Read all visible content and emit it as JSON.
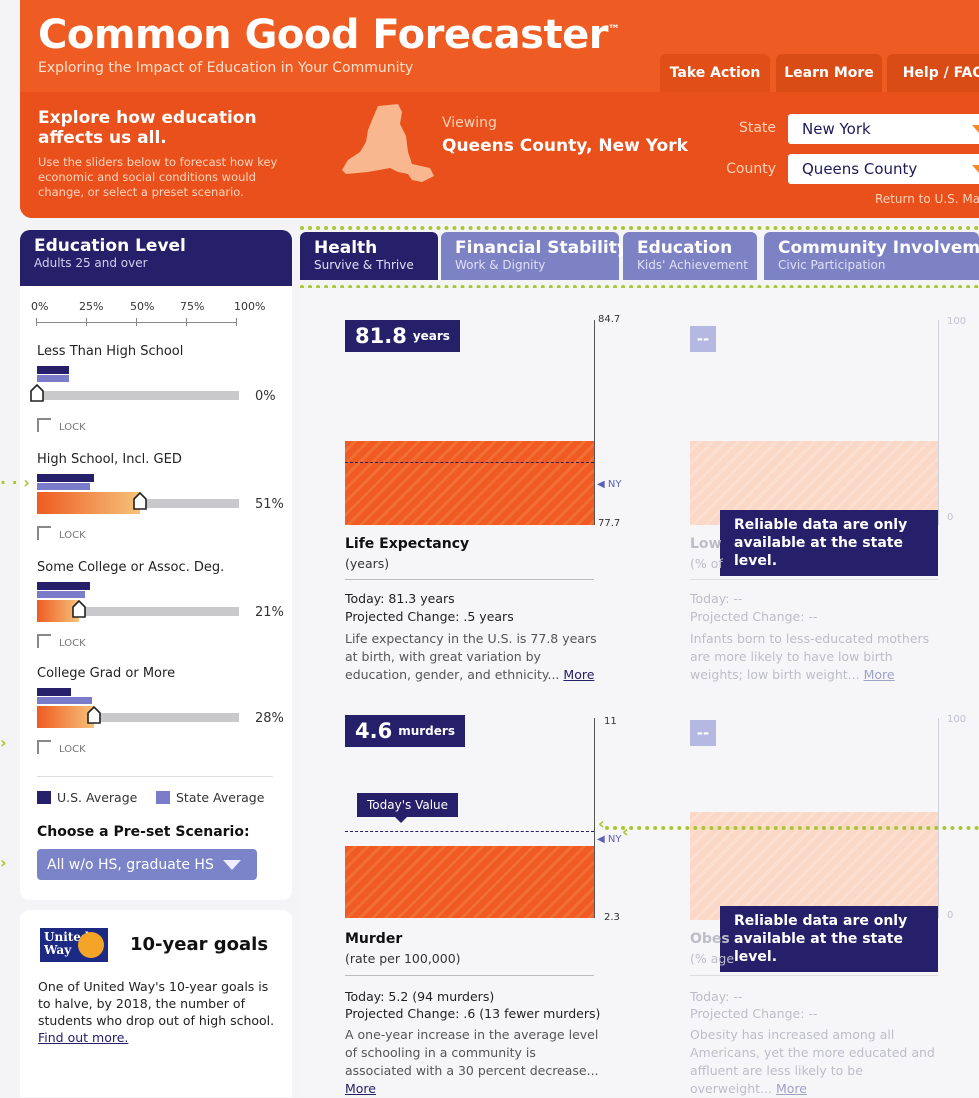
{
  "header": {
    "brand": "Common Good Forecaster",
    "trademark": "™",
    "subtitle": "Exploring the Impact of Education in Your Community",
    "nav": [
      "Take Action",
      "Learn More",
      "Help / FAQ"
    ],
    "explore_title": "Explore how education affects us all.",
    "explore_text": "Use the sliders below to forecast how key economic and social conditions would change, or select a preset scenario.",
    "viewing_label": "Viewing",
    "viewing_value": "Queens County, New York",
    "state_label": "State",
    "state_value": "New York",
    "county_label": "County",
    "county_value": "Queens County",
    "return_link": "Return to U.S. Ma"
  },
  "education_panel": {
    "title": "Education Level",
    "subtitle": "Adults 25 and over",
    "scale": [
      "0%",
      "25%",
      "50%",
      "75%",
      "100%"
    ],
    "lock_label": "LOCK",
    "sliders": [
      {
        "label": "Less Than High School",
        "value": "0%",
        "fraction": 0.0,
        "us": 0.16,
        "state": 0.16
      },
      {
        "label": "High School, Incl. GED",
        "value": "51%",
        "fraction": 0.51,
        "us": 0.28,
        "state": 0.26
      },
      {
        "label": "Some College or Assoc. Deg.",
        "value": "21%",
        "fraction": 0.21,
        "us": 0.26,
        "state": 0.24
      },
      {
        "label": "College Grad or More",
        "value": "28%",
        "fraction": 0.28,
        "us": 0.17,
        "state": 0.27
      }
    ],
    "legend_us": "U.S. Average",
    "legend_state": "State Average",
    "preset_title": "Choose a Pre-set Scenario:",
    "preset_value": "All w/o HS, graduate HS",
    "colors": {
      "us": "#26206b",
      "state": "#7b7cc9",
      "accent": "#ee5c23"
    }
  },
  "goals": {
    "logo_text": "United Way",
    "title": "10-year goals",
    "text": "One of United Way's 10-year goals is to halve, by 2018, the number of students who drop out of high school.",
    "link": "Find out more."
  },
  "tabs": [
    {
      "title": "Health",
      "sub": "Survive & Thrive"
    },
    {
      "title": "Financial Stability",
      "sub": "Work & Dignity"
    },
    {
      "title": "Education",
      "sub": "Kids' Achievement"
    },
    {
      "title": "Community Involvement",
      "sub": "Civic Participation"
    }
  ],
  "metrics": {
    "life": {
      "value": "81.8",
      "unit": "years",
      "axis_max": "84.7",
      "axis_min": "77.7",
      "ny": "NY",
      "title": "Life Expectancy",
      "sub": "(years)",
      "today": "Today: 81.3 years",
      "projected": "Projected Change: .5 years",
      "desc": "Life expectancy in the U.S. is 77.8 years at birth, with great variation by education, gender, and ethnicity...",
      "more": "More"
    },
    "lowbirth": {
      "value": "--",
      "axis_max": "100",
      "axis_min": "0",
      "overlay": "Reliable data are only available at the state level.",
      "title": "Low",
      "sub": "(% of",
      "today": "Today: --",
      "projected": "Projected Change: --",
      "desc": "Infants born to less-educated mothers are more likely to have low birth weights; low birth weight...",
      "more": "More"
    },
    "murder": {
      "value": "4.6",
      "unit": "murders",
      "axis_max": "11",
      "axis_min": "2.3",
      "ny": "NY",
      "todays_value": "Today's Value",
      "title": "Murder",
      "sub": "(rate per 100,000)",
      "today": "Today: 5.2 (94 murders)",
      "projected": "Projected Change: .6 (13 fewer murders)",
      "desc": "A one-year increase in the average level of schooling in a community is associated with a 30 percent decrease...",
      "more": "More"
    },
    "obesity": {
      "value": "--",
      "axis_max": "100",
      "axis_min": "0",
      "overlay": "Reliable data are only available at the state level.",
      "title": "Obes",
      "sub": "(% age",
      "today": "Today: --",
      "projected": "Projected Change: --",
      "desc": "Obesity has increased among all Americans, yet the more educated and affluent are less likely to be overweight...",
      "more": "More"
    }
  }
}
